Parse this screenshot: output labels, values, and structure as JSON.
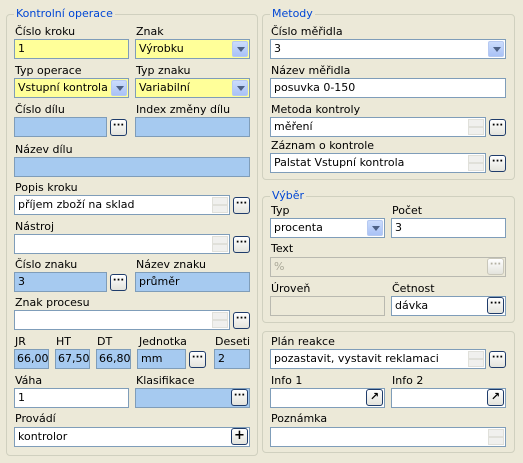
{
  "kontrolni_operace": {
    "title": "Kontrolní operace",
    "cislo_kroku": {
      "label": "Číslo kroku",
      "value": "1"
    },
    "znak": {
      "label": "Znak",
      "value": "Výrobku"
    },
    "typ_operace": {
      "label": "Typ operace",
      "value": "Vstupní kontrola"
    },
    "typ_znaku": {
      "label": "Typ znaku",
      "value": "Variabilní"
    },
    "cislo_dilu": {
      "label": "Číslo dílu",
      "value": ""
    },
    "index_zmeny_dilu": {
      "label": "Index změny dílu",
      "value": ""
    },
    "nazev_dilu": {
      "label": "Název dílu",
      "value": ""
    },
    "popis_kroku": {
      "label": "Popis kroku",
      "value": "příjem zboží na sklad"
    },
    "nastroj": {
      "label": "Nástroj",
      "value": ""
    },
    "cislo_znaku": {
      "label": "Číslo znaku",
      "value": "3"
    },
    "nazev_znaku": {
      "label": "Název znaku",
      "value": "průměr"
    },
    "znak_procesu": {
      "label": "Znak procesu",
      "value": ""
    },
    "jr": {
      "label": "JR",
      "value": "66,00"
    },
    "ht": {
      "label": "HT",
      "value": "67,50"
    },
    "dt": {
      "label": "DT",
      "value": "66,80"
    },
    "jednotka": {
      "label": "Jednotka",
      "value": "mm"
    },
    "deseti": {
      "label": "Deseti",
      "value": "2"
    },
    "vaha": {
      "label": "Váha",
      "value": "1"
    },
    "klasifikace": {
      "label": "Klasifikace",
      "value": ""
    },
    "provadi": {
      "label": "Provádí",
      "value": "kontrolor"
    }
  },
  "metody": {
    "title": "Metody",
    "cislo_meridla": {
      "label": "Číslo měřidla",
      "value": "3"
    },
    "nazev_meridla": {
      "label": "Název měřidla",
      "value": "posuvka 0-150"
    },
    "metoda_kontroly": {
      "label": "Metoda kontroly",
      "value": "měření"
    },
    "zaznam_o_kontrole": {
      "label": "Záznam o kontrole",
      "value": "Palstat Vstupní kontrola"
    }
  },
  "vyber": {
    "title": "Výběr",
    "typ": {
      "label": "Typ",
      "value": "procenta"
    },
    "pocet": {
      "label": "Počet",
      "value": "3"
    },
    "text": {
      "label": "Text",
      "value": "%"
    },
    "uroven": {
      "label": "Úroveň",
      "value": ""
    },
    "cetnost": {
      "label": "Četnost",
      "value": "dávka"
    }
  },
  "plan_reakce": {
    "label": "Plán reakce",
    "value": "pozastavit, vystavit reklamaci",
    "info1": {
      "label": "Info 1",
      "value": ""
    },
    "info2": {
      "label": "Info 2",
      "value": ""
    },
    "poznamka": {
      "label": "Poznámka",
      "value": ""
    }
  },
  "buttons": {
    "ellipsis": "···",
    "plus": "+",
    "arrow": "↗"
  },
  "icons": {
    "combo_arrow": "chevron-down-icon",
    "spin": "spin-updown-icon",
    "jump": "jump-arrow-icon"
  },
  "colors": {
    "required": "#ffff99",
    "lookup": "#a6caf0",
    "legend": "#0046d5",
    "panel": "#ece9d8"
  }
}
